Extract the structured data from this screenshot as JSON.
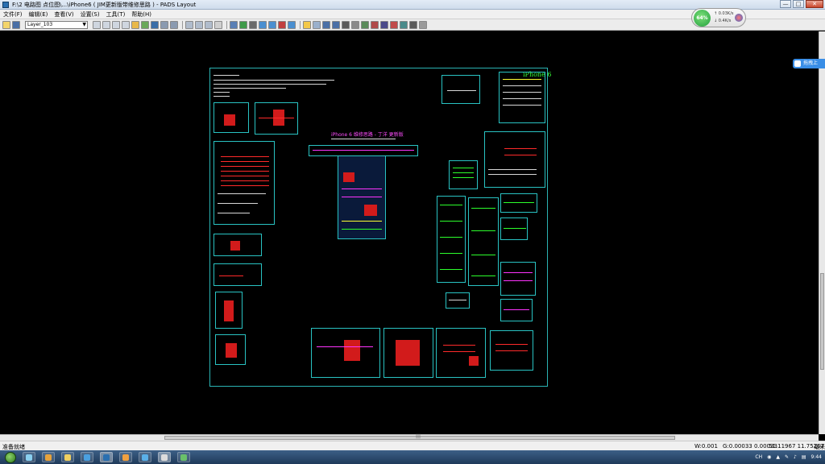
{
  "window": {
    "title": "F:\\2 电路图 点位图\\...\\iPhone6 ( JIM更新版带维修思路 ) - PADS Layout",
    "controls": [
      "—",
      "□",
      "✕"
    ]
  },
  "menu": [
    "文件(F)",
    "编辑(E)",
    "查看(V)",
    "设置(S)",
    "工具(T)",
    "帮助(H)"
  ],
  "toolbar": {
    "layer": "Layer_103"
  },
  "netwidget": {
    "percent": "64%",
    "up": "0.03K/s",
    "down": "0.4K/s"
  },
  "floattab": {
    "label": "拖拽上"
  },
  "board": {
    "title": "iPhone 6",
    "center_title": "iPhone 6 维修思路 - 丁洋 更新版"
  },
  "status": {
    "ready": "准备就绪",
    "w": "W:0.001",
    "g": "G:0.00033 0.00033",
    "xy": "51.11967 11.75267",
    "unit": "毫米"
  },
  "taskbar": {
    "time": "9:44",
    "tray_lang": "CH"
  },
  "colors": {
    "board_outline": "#2bb4b4",
    "text_green": "#36ff36",
    "text_magenta": "#ff4dff",
    "trace_red": "#d21b1b"
  }
}
